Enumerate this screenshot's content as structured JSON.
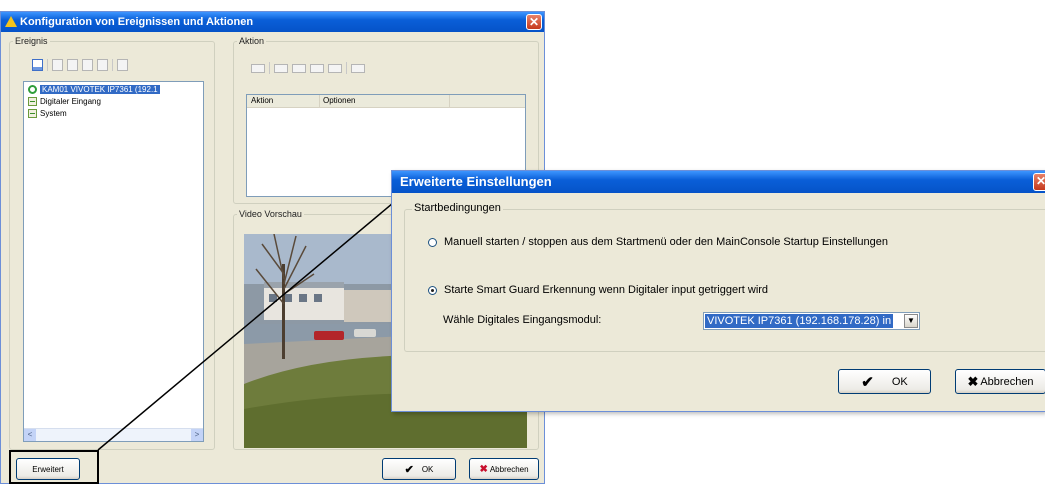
{
  "main_window": {
    "title": "Konfiguration von Ereignissen und Aktionen",
    "close_symbol": "✕",
    "groups": {
      "ereignis": "Ereignis",
      "aktion": "Aktion",
      "video": "Video Vorschau"
    },
    "tree": [
      {
        "label": "KAM01 VIVOTEK IP7361 (192.1",
        "icon": "camera-icon",
        "selected": true
      },
      {
        "label": "Digitaler Eingang",
        "icon": "digital-input-icon",
        "selected": false
      },
      {
        "label": "System",
        "icon": "system-icon",
        "selected": false
      }
    ],
    "action_list": {
      "columns": [
        "Aktion",
        "Optionen"
      ]
    },
    "scroll_left": "<",
    "scroll_right": ">",
    "buttons": {
      "erweitert": "Erweitert",
      "ok": "OK",
      "abbrechen": "Abbrechen"
    },
    "check_glyph": "✔",
    "x_glyph": "✖"
  },
  "dialog2": {
    "title": "Erweiterte Einstellungen",
    "close_symbol": "✕",
    "group_label": "Startbedingungen",
    "radio_manual": "Manuell starten / stoppen aus dem Startmenü oder den MainConsole Startup Einstellungen",
    "radio_digital": "Starte Smart Guard Erkennung wenn Digitaler input getriggert wird",
    "module_label": "Wähle Digitales Eingangsmodul:",
    "module_value": "VIVOTEK IP7361 (192.168.178.28) in",
    "selected_option": "digital",
    "dropdown_arrow": "▼",
    "ok": "OK",
    "cancel": "Abbrechen",
    "check_glyph": "✔",
    "x_glyph": "✖"
  }
}
